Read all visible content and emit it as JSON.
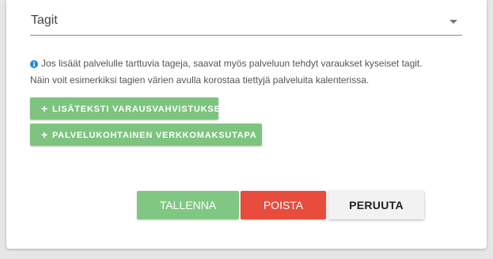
{
  "tags_field": {
    "label": "Tagit"
  },
  "info": {
    "line1": "Jos lisäät palvelulle tarttuvia tageja, saavat myös palveluun tehdyt varaukset kyseiset tagit.",
    "line2": "Näin voit esimerkiksi tagien värien avulla korostaa tiettyjä palveluita kalenterissa.",
    "icon": "info-icon"
  },
  "buttons": {
    "add_confirmation_text": "LISÄTEKSTI VARAUSVAHVISTUKSEEN",
    "service_payment_method": "PALVELUKOHTAINEN VERKKOMAKSUTAPA",
    "plus": "+",
    "save": "TALLENNA",
    "delete": "POISTA",
    "cancel": "PERUUTA"
  },
  "colors": {
    "green_button": "#7dc47f",
    "save_button": "#81c784",
    "delete_button": "#e74c3c",
    "cancel_button": "#f2f2f2",
    "info_icon": "#1e88e5"
  }
}
